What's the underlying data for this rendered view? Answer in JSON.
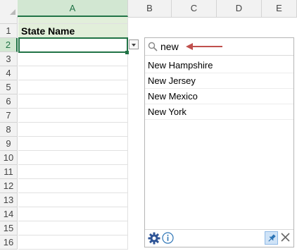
{
  "columns": [
    "A",
    "B",
    "C",
    "D",
    "E"
  ],
  "selected_column": "A",
  "rows": [
    "1",
    "2",
    "3",
    "4",
    "5",
    "6",
    "7",
    "8",
    "9",
    "10",
    "11",
    "12",
    "13",
    "14",
    "15",
    "16"
  ],
  "selected_row": "2",
  "cells": {
    "a1": "State Name",
    "a2": ""
  },
  "panel": {
    "search_value": "new",
    "items": [
      "New Hampshire",
      "New Jersey",
      "New Mexico",
      "New York"
    ]
  },
  "colors": {
    "accent_green": "#217346",
    "header_highlight": "#d2e7d2",
    "a1_fill": "#e2efda",
    "arrow_red": "#c0504d",
    "pin_blue": "#cfe3f7"
  },
  "icons": [
    "search-icon",
    "arrow-pointer-icon",
    "gear-icon",
    "info-icon",
    "pin-icon",
    "close-icon",
    "dropdown-arrow-icon"
  ]
}
